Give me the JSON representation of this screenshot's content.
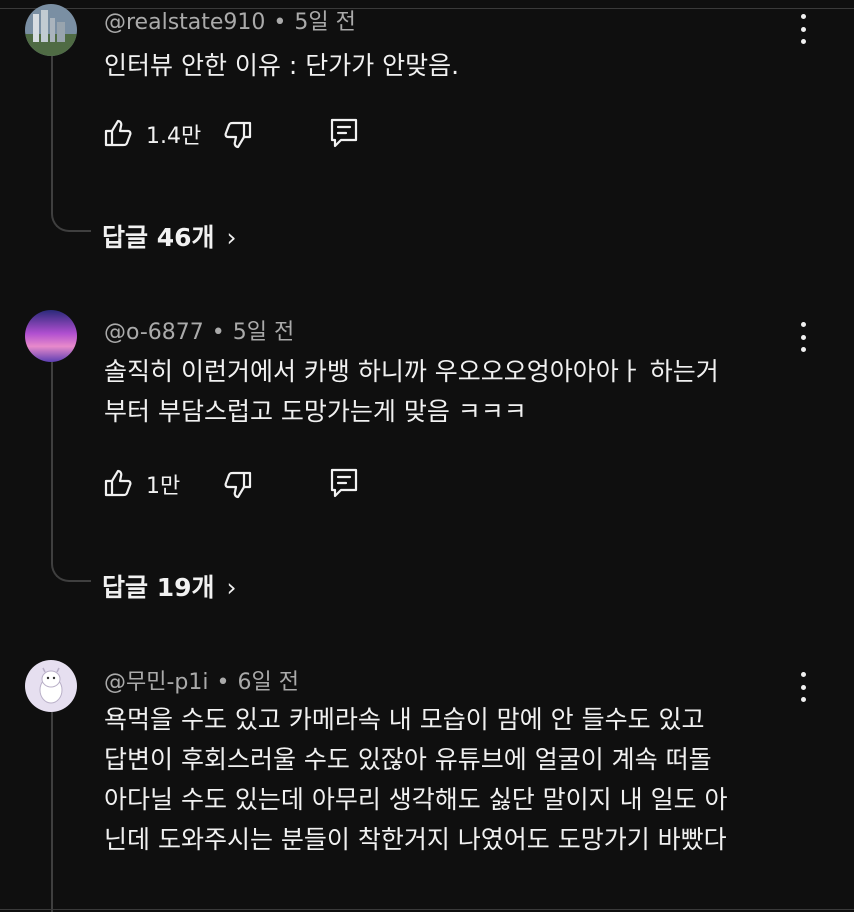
{
  "comments": [
    {
      "author": "@realstate910",
      "time": "5일 전",
      "lines": [
        "인터뷰 안한 이유 : 단가가 안맞음."
      ],
      "likes": "1.4만",
      "replies_label": "답글 46개",
      "avatar": "city-skyline-avatar"
    },
    {
      "author": "@o-6877",
      "time": "5일 전",
      "lines": [
        "솔직히 이런거에서 카뱅 하니까 우오오오엉아아아ㅏ 하는거",
        "부터 부담스럽고 도망가는게 맞음 ㅋㅋㅋ"
      ],
      "likes": "1만",
      "replies_label": "답글 19개",
      "avatar": "purple-sky-avatar"
    },
    {
      "author": "@무민-p1i",
      "time": "6일 전",
      "lines": [
        "욕먹을 수도 있고 카메라속 내 모습이 맘에 안 들수도 있고",
        "답변이 후회스러울 수도 있잖아 유튜브에 얼굴이 계속 떠돌",
        "아다닐 수도 있는데 아무리 생각해도 싫단 말이지 내 일도 아",
        "닌데 도와주시는 분들이 착한거지 나였어도 도망가기 바빴다"
      ],
      "avatar": "moomin-avatar"
    }
  ],
  "separator": "•",
  "colors": {
    "background": "#0f0f0f",
    "text": "#f1f1f1",
    "muted": "#aaaaaa",
    "thread": "#3f3f3f"
  },
  "icons": {
    "like": "thumb-up-icon",
    "dislike": "thumb-down-icon",
    "reply": "reply-icon",
    "menu": "kebab-menu-icon",
    "expand": "chevron-right-icon"
  }
}
